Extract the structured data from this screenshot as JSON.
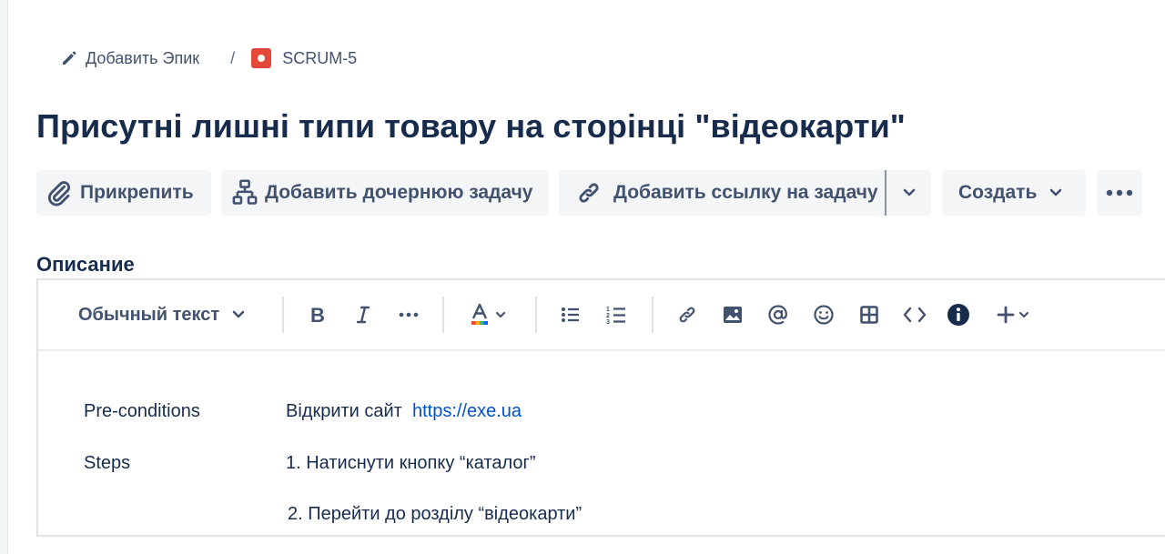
{
  "breadcrumbs": {
    "epic_label": "Добавить Эпик",
    "separator": "/",
    "issue_key": "SCRUM-5"
  },
  "issue": {
    "title": "Присутні лишні типи товару на сторінці \"відеокарти\""
  },
  "actions": {
    "attach": "Прикрепить",
    "add_child": "Добавить дочернюю задачу",
    "add_link": "Добавить ссылку на задачу",
    "create": "Создать",
    "more_icon": "ellipsis-icon"
  },
  "description": {
    "label": "Описание",
    "toolbar": {
      "text_style": "Обычный текст",
      "icons": [
        "bold-icon",
        "italic-icon",
        "more-formatting-icon",
        "text-color-icon",
        "bullet-list-icon",
        "numbered-list-icon",
        "link-icon",
        "image-icon",
        "mention-icon",
        "emoji-icon",
        "table-icon",
        "code-icon",
        "info-panel-icon",
        "insert-icon"
      ]
    },
    "content": {
      "precond_label": "Pre-conditions",
      "precond_text": "Відкрити сайт",
      "precond_link": "https://exe.ua",
      "steps_label": "Steps",
      "step1": "1. Натиснути кнопку “каталог”",
      "step2": "2. Перейти до розділу “відеокарти”"
    }
  },
  "colors": {
    "bug_icon": "#e5493a",
    "link": "#0052cc",
    "text": "#172b4d",
    "button_bg": "#f4f5f7"
  }
}
